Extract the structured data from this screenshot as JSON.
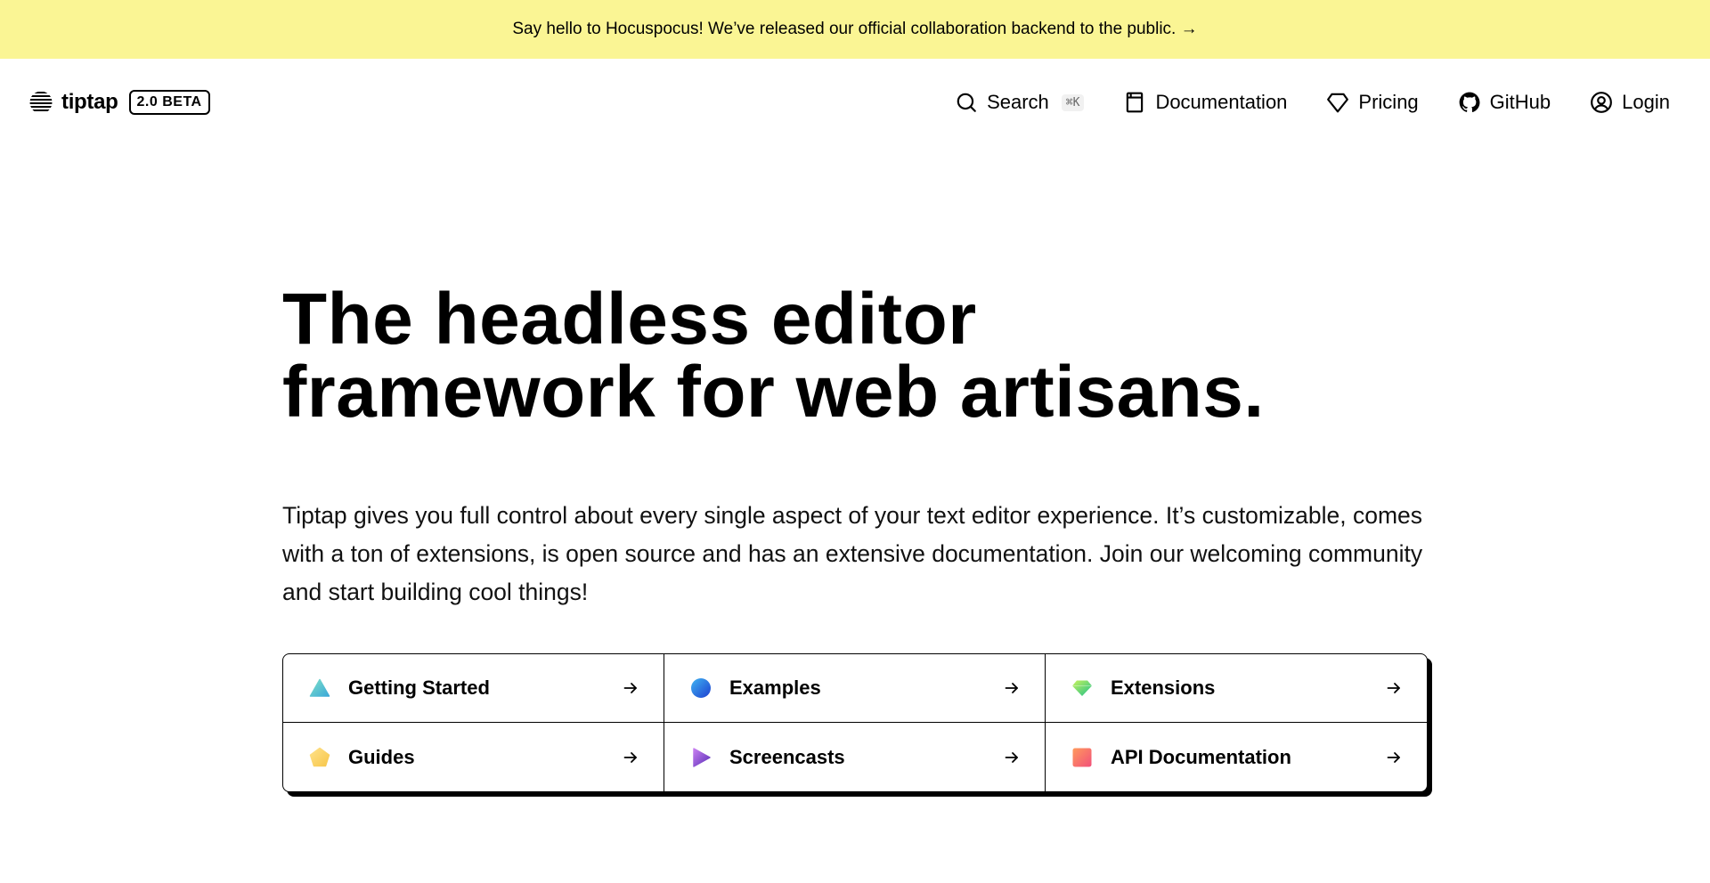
{
  "announcement": {
    "text": "Say hello to Hocuspocus! We’ve released our official collaboration backend to the public. →"
  },
  "brand": {
    "name": "tiptap",
    "badge": "2.0 BETA",
    "icon": "tiptap-logo-icon"
  },
  "nav": {
    "search_label": "Search",
    "search_shortcut": "⌘K",
    "documentation_label": "Documentation",
    "pricing_label": "Pricing",
    "github_label": "GitHub",
    "login_label": "Login"
  },
  "hero": {
    "title_line1": "The headless editor",
    "title_line2": "framework for web artisans.",
    "description": "Tiptap gives you full control about every single aspect of your text editor experience. It’s customizable, comes with a ton of extensions, is open source and has an extensive documentation. Join our welcoming community and start building cool things!"
  },
  "cards": [
    {
      "label": "Getting Started",
      "icon": "triangle-icon"
    },
    {
      "label": "Examples",
      "icon": "circle-icon"
    },
    {
      "label": "Extensions",
      "icon": "gem-icon"
    },
    {
      "label": "Guides",
      "icon": "pentagon-icon"
    },
    {
      "label": "Screencasts",
      "icon": "play-icon"
    },
    {
      "label": "API Documentation",
      "icon": "square-icon"
    }
  ],
  "colors": {
    "announcement_bg": "#faf594",
    "text": "#000000"
  }
}
